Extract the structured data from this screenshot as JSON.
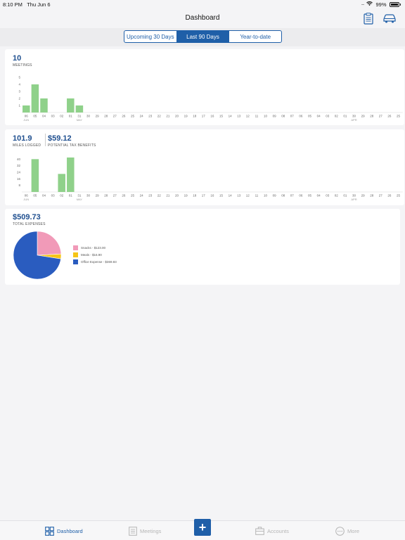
{
  "status": {
    "time": "8:10 PM",
    "date": "Thu Jun 6",
    "battery": "99%"
  },
  "header": {
    "title": "Dashboard",
    "clipboard_icon": "clipboard-icon",
    "car_icon": "car-icon"
  },
  "segments": [
    {
      "label": "Upcoming 30 Days",
      "active": false
    },
    {
      "label": "Last 90 Days",
      "active": true
    },
    {
      "label": "Year-to-date",
      "active": false
    }
  ],
  "meetings": {
    "value": "10",
    "label": "MEETINGS"
  },
  "miles": {
    "value": "101.9",
    "label": "MILES LOGGED"
  },
  "tax": {
    "value": "$59.12",
    "label": "POTENTIAL TAX BENEFITS"
  },
  "expenses": {
    "value": "$509.73",
    "label": "TOTAL EXPENSES"
  },
  "chart_data": [
    {
      "type": "bar",
      "categories": [
        "06",
        "05",
        "04",
        "03",
        "02",
        "01",
        "31",
        "30",
        "29",
        "28",
        "27",
        "26",
        "25",
        "24",
        "23",
        "22",
        "21",
        "20",
        "19",
        "18",
        "17",
        "16",
        "15",
        "14",
        "13",
        "12",
        "11",
        "10",
        "09",
        "08",
        "07",
        "06",
        "05",
        "04",
        "03",
        "02",
        "01",
        "30",
        "29",
        "28",
        "27",
        "26",
        "25"
      ],
      "month_labels": [
        {
          "index": 0,
          "label": "JUN"
        },
        {
          "index": 6,
          "label": "MAY"
        },
        {
          "index": 37,
          "label": "APR"
        }
      ],
      "values": [
        1,
        4,
        2,
        0,
        0,
        2,
        1,
        0,
        0,
        0,
        0,
        0,
        0,
        0,
        0,
        0,
        0,
        0,
        0,
        0,
        0,
        0,
        0,
        0,
        0,
        0,
        0,
        0,
        0,
        0,
        0,
        0,
        0,
        0,
        0,
        0,
        0,
        0,
        0,
        0,
        0,
        0,
        0
      ],
      "yticks": [
        1,
        2,
        3,
        4,
        5
      ],
      "ylim": [
        0,
        5
      ],
      "color": "#8fd18a"
    },
    {
      "type": "bar",
      "categories": [
        "06",
        "05",
        "04",
        "03",
        "02",
        "01",
        "31",
        "30",
        "29",
        "28",
        "27",
        "26",
        "25",
        "24",
        "23",
        "22",
        "21",
        "20",
        "19",
        "18",
        "17",
        "16",
        "15",
        "14",
        "13",
        "12",
        "11",
        "10",
        "09",
        "08",
        "07",
        "06",
        "05",
        "04",
        "03",
        "02",
        "01",
        "30",
        "29",
        "28",
        "27",
        "26",
        "25"
      ],
      "month_labels": [
        {
          "index": 0,
          "label": "JUN"
        },
        {
          "index": 6,
          "label": "MAY"
        },
        {
          "index": 37,
          "label": "APR"
        }
      ],
      "values": [
        0,
        40,
        0,
        0,
        22,
        42,
        0,
        0,
        0,
        0,
        0,
        0,
        0,
        0,
        0,
        0,
        0,
        0,
        0,
        0,
        0,
        0,
        0,
        0,
        0,
        0,
        0,
        0,
        0,
        0,
        0,
        0,
        0,
        0,
        0,
        0,
        0,
        0,
        0,
        0,
        0,
        0,
        0
      ],
      "yticks": [
        8,
        16,
        24,
        32,
        40
      ],
      "ylim": [
        0,
        48
      ],
      "color": "#8fd18a"
    },
    {
      "type": "pie",
      "labels": [
        "Snacks - $123.00",
        "Meals - $16.90",
        "Office Expense - $369.83"
      ],
      "values": [
        123.0,
        16.9,
        369.83
      ],
      "colors": [
        "#f19ab8",
        "#f5c518",
        "#2a5cbf"
      ]
    }
  ],
  "tabs": [
    {
      "label": "Dashboard",
      "icon": "dashboard-icon",
      "active": true
    },
    {
      "label": "Meetings",
      "icon": "meetings-icon",
      "active": false
    },
    {
      "label": "Accounts",
      "icon": "briefcase-icon",
      "active": false
    },
    {
      "label": "More",
      "icon": "more-icon",
      "active": false
    }
  ],
  "fab": {
    "label": "+"
  }
}
